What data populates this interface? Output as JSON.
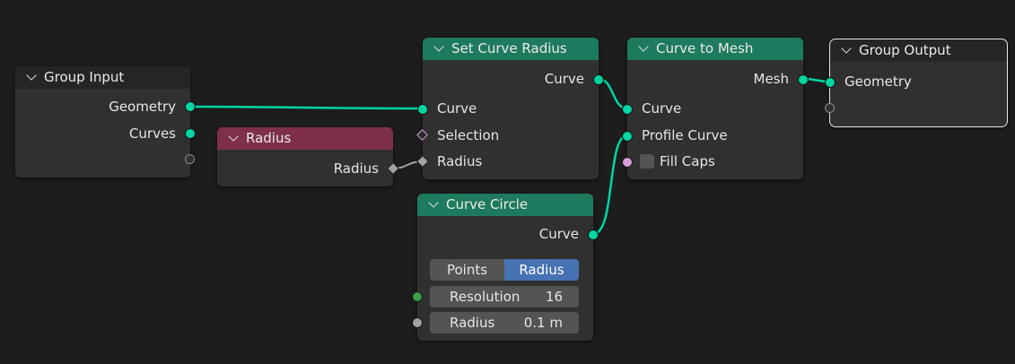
{
  "colors": {
    "background": "#1d1d1d",
    "geometry_header": "#1e7a5f",
    "input_header": "#7e2f49",
    "group_header": "#252525",
    "geometry_socket": "#00d6a3",
    "active_toggle": "#4772b3"
  },
  "nodes": {
    "group_input": {
      "title": "Group Input",
      "outputs": [
        "Geometry",
        "Curves"
      ]
    },
    "radius_input": {
      "title": "Radius",
      "output": "Radius"
    },
    "set_curve_radius": {
      "title": "Set Curve Radius",
      "output": "Curve",
      "inputs": [
        "Curve",
        "Selection",
        "Radius"
      ]
    },
    "curve_to_mesh": {
      "title": "Curve to Mesh",
      "output": "Mesh",
      "inputs": [
        "Curve",
        "Profile Curve"
      ],
      "fill_caps_label": "Fill Caps",
      "fill_caps_checked": false
    },
    "group_output": {
      "title": "Group Output",
      "input": "Geometry"
    },
    "curve_circle": {
      "title": "Curve Circle",
      "output": "Curve",
      "mode_options": [
        "Points",
        "Radius"
      ],
      "mode_selected": "Radius",
      "resolution_label": "Resolution",
      "resolution_value": "16",
      "radius_label": "Radius",
      "radius_value": "0.1 m"
    }
  }
}
